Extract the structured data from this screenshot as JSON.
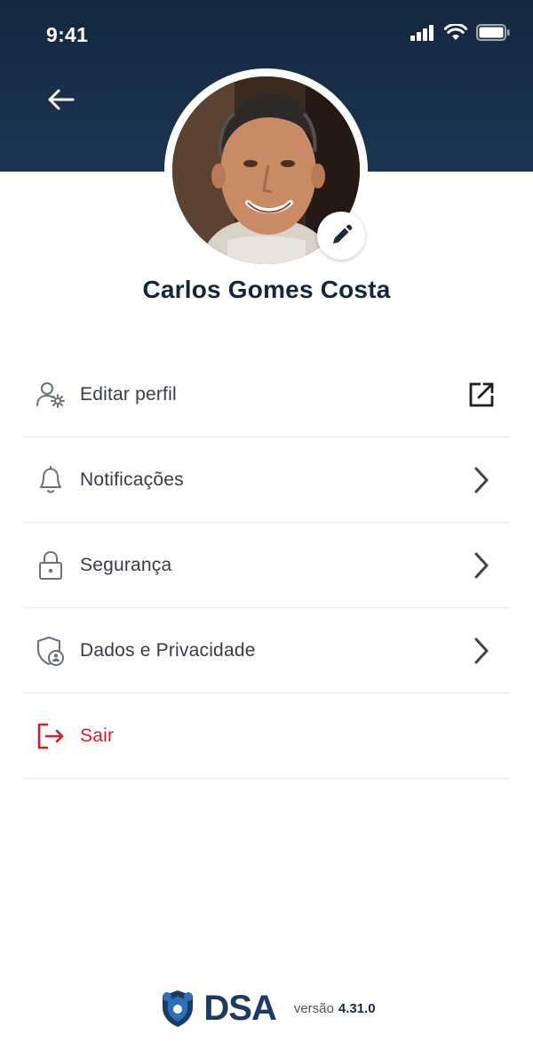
{
  "status_bar": {
    "time": "9:41"
  },
  "profile": {
    "name": "Carlos Gomes Costa"
  },
  "menu": {
    "items": [
      {
        "label": "Editar perfil",
        "icon": "user-settings-icon",
        "trail_icon": "external-link-icon"
      },
      {
        "label": "Notificações",
        "icon": "bell-icon",
        "trail_icon": "chevron-right-icon"
      },
      {
        "label": "Segurança",
        "icon": "lock-icon",
        "trail_icon": "chevron-right-icon"
      },
      {
        "label": "Dados e Privacidade",
        "icon": "shield-user-icon",
        "trail_icon": "chevron-right-icon"
      },
      {
        "label": "Sair",
        "icon": "logout-icon",
        "trail_icon": ""
      }
    ]
  },
  "footer": {
    "brand": "DSA",
    "version_label": "versão",
    "version_number": "4.31.0"
  },
  "colors": {
    "header_bg": "#14283f",
    "name_text": "#16253d",
    "danger": "#d21f26",
    "brand": "#1c3a64"
  }
}
